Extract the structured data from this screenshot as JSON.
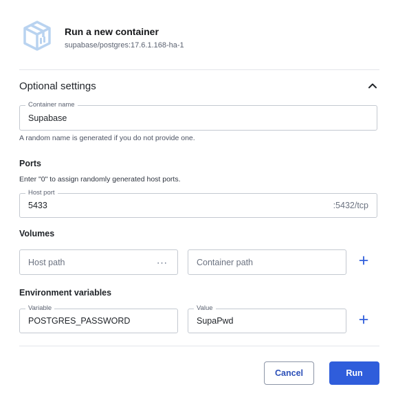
{
  "header": {
    "title": "Run a new container",
    "image": "supabase/postgres:17.6.1.168-ha-1",
    "icon": "container-cube-icon"
  },
  "optional": {
    "title": "Optional settings",
    "toggle_icon": "chevron-up-icon"
  },
  "container_name": {
    "label": "Container name",
    "value": "Supabase",
    "helper": "A random name is generated if you do not provide one."
  },
  "ports": {
    "title": "Ports",
    "description": "Enter \"0\" to assign randomly generated host ports.",
    "host_port_label": "Host port",
    "host_port_value": "5433",
    "container_port": ":5432/tcp"
  },
  "volumes": {
    "title": "Volumes",
    "host_path_placeholder": "Host path",
    "browse_label": "···",
    "container_path_placeholder": "Container path",
    "add_icon": "plus-icon"
  },
  "env": {
    "title": "Environment variables",
    "variable_label": "Variable",
    "variable_value": "POSTGRES_PASSWORD",
    "value_label": "Value",
    "value_value": "SupaPwd",
    "add_icon": "plus-icon"
  },
  "actions": {
    "cancel_label": "Cancel",
    "run_label": "Run"
  },
  "colors": {
    "primary": "#2f5ddb",
    "accent_icon": "#b9d3f0",
    "border": "#c3c8d0"
  }
}
